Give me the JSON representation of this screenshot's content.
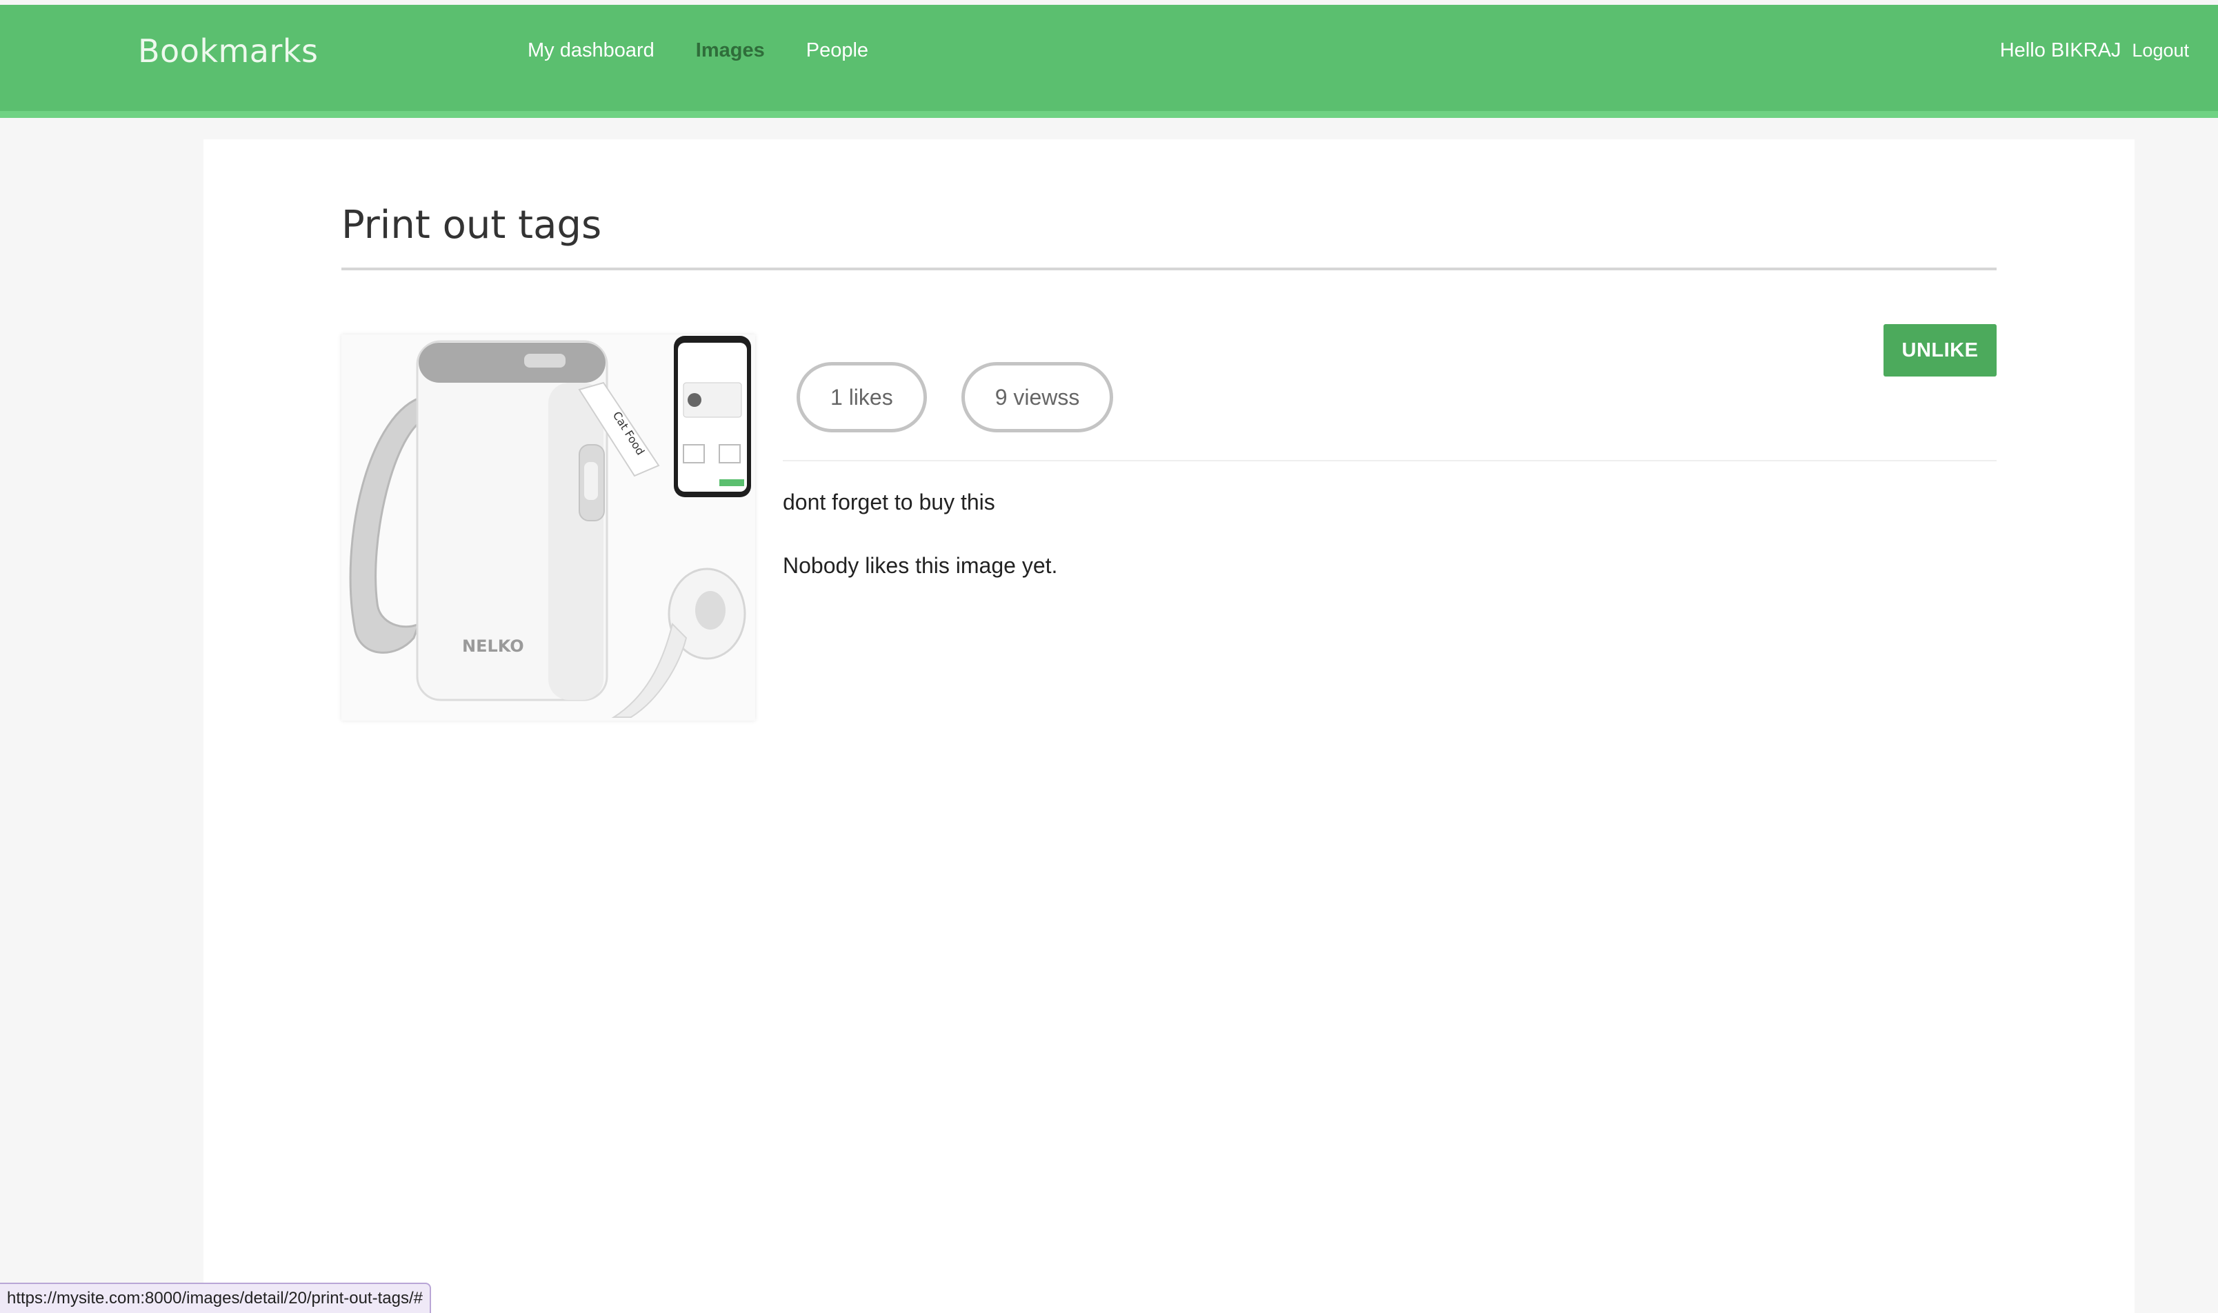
{
  "header": {
    "logo": "Bookmarks",
    "nav": [
      {
        "label": "My dashboard",
        "active": false
      },
      {
        "label": "Images",
        "active": true
      },
      {
        "label": "People",
        "active": false
      }
    ],
    "greeting": "Hello BIKRAJ",
    "logout_label": "Logout"
  },
  "image_detail": {
    "title": "Print out tags",
    "likes_label": "1 likes",
    "views_label": "9 viewss",
    "action_button_label": "UNLIKE",
    "description": "dont forget to buy this",
    "likers_text": "Nobody likes this image yet.",
    "product_brand_text": "NELKO",
    "product_label_text": "Cat Food"
  },
  "status_bar": {
    "url": "https://mysite.com:8000/images/detail/20/print-out-tags/#"
  },
  "colors": {
    "header_bg": "#5bbf6f",
    "active_nav": "#2f6d3a",
    "button_bg": "#4caa5c",
    "page_bg": "#f6f6f6"
  }
}
